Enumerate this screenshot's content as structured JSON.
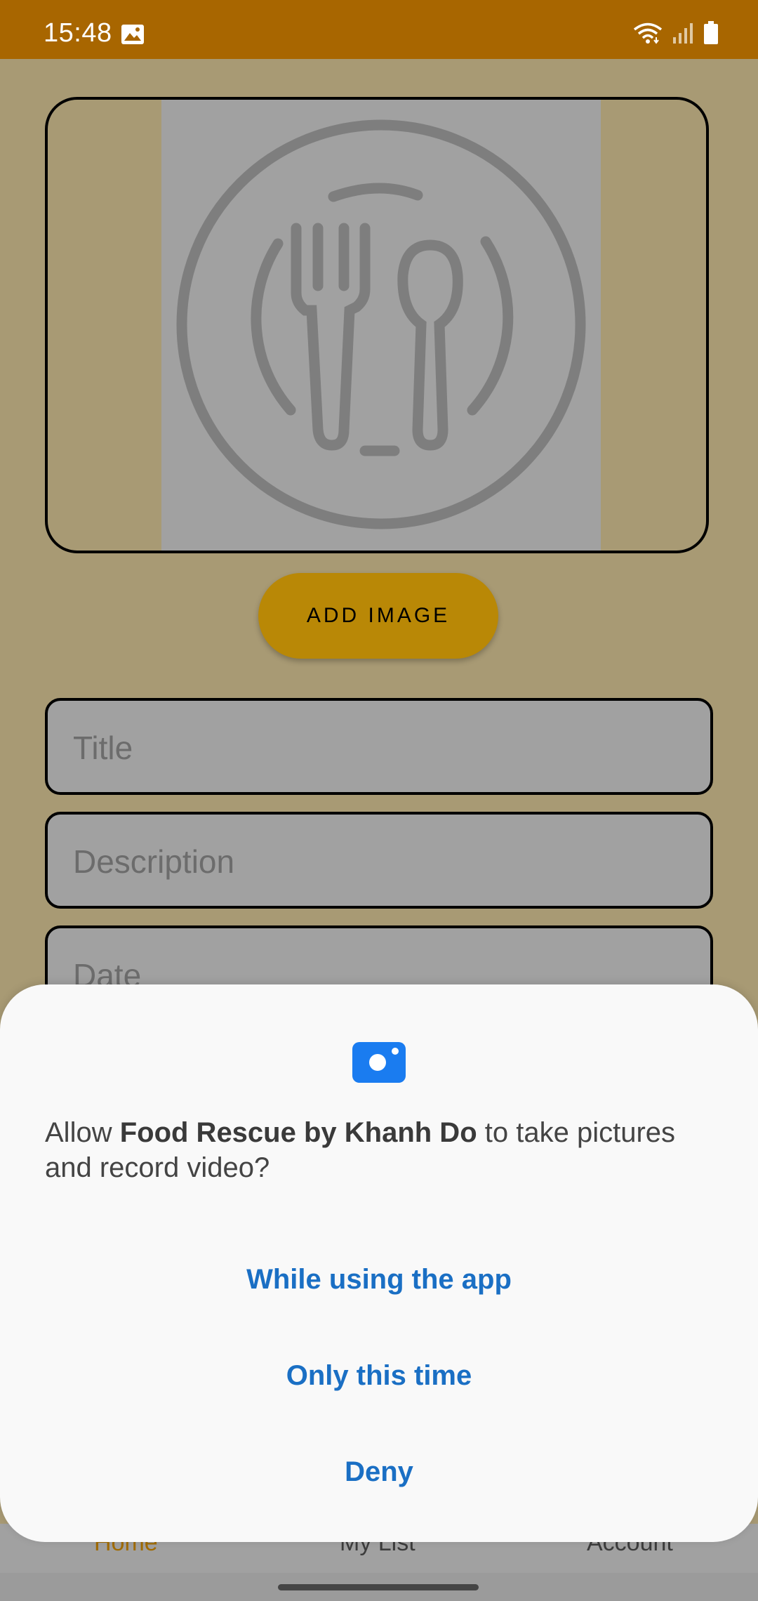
{
  "status_bar": {
    "time": "15:48",
    "icons": [
      "image-notification-icon",
      "wifi-icon",
      "signal-icon",
      "battery-icon"
    ],
    "bg_color": "#a86600"
  },
  "form": {
    "image_placeholder_icon": "plate-fork-spoon-icon",
    "add_image_label": "ADD IMAGE",
    "title_placeholder": "Title",
    "description_placeholder": "Description",
    "date_placeholder": "Date"
  },
  "bottom_nav": {
    "items": [
      {
        "label": "Home",
        "active": true
      },
      {
        "label": "My List",
        "active": false
      },
      {
        "label": "Account",
        "active": false
      }
    ]
  },
  "permission_dialog": {
    "icon": "camera-icon",
    "message_prefix": "Allow ",
    "app_name": "Food Rescue by Khanh Do",
    "message_suffix": " to take pictures and record video?",
    "options": [
      "While using the app",
      "Only this time",
      "Deny"
    ],
    "accent_color": "#1a6fc4"
  }
}
